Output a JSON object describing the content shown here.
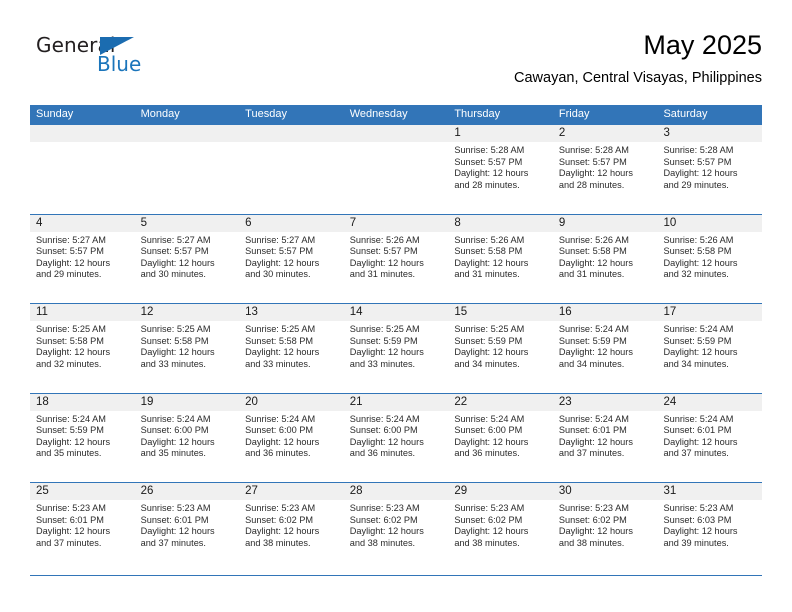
{
  "brand": {
    "name_part1": "General",
    "name_part2": "Blue",
    "flag_icon": "triangle-flag-icon"
  },
  "header": {
    "month_title": "May 2025",
    "location": "Cawayan, Central Visayas, Philippines"
  },
  "colors": {
    "header_blue": "#3275b8",
    "brand_blue": "#1b75bb",
    "day_band_gray": "#f0f0f0",
    "text": "#000000"
  },
  "weekdays": [
    "Sunday",
    "Monday",
    "Tuesday",
    "Wednesday",
    "Thursday",
    "Friday",
    "Saturday"
  ],
  "weeks": [
    [
      {
        "day": "",
        "empty": true
      },
      {
        "day": "",
        "empty": true
      },
      {
        "day": "",
        "empty": true
      },
      {
        "day": "",
        "empty": true
      },
      {
        "day": "1",
        "sunrise": "Sunrise: 5:28 AM",
        "sunset": "Sunset: 5:57 PM",
        "daylight1": "Daylight: 12 hours",
        "daylight2": "and 28 minutes."
      },
      {
        "day": "2",
        "sunrise": "Sunrise: 5:28 AM",
        "sunset": "Sunset: 5:57 PM",
        "daylight1": "Daylight: 12 hours",
        "daylight2": "and 28 minutes."
      },
      {
        "day": "3",
        "sunrise": "Sunrise: 5:28 AM",
        "sunset": "Sunset: 5:57 PM",
        "daylight1": "Daylight: 12 hours",
        "daylight2": "and 29 minutes."
      }
    ],
    [
      {
        "day": "4",
        "sunrise": "Sunrise: 5:27 AM",
        "sunset": "Sunset: 5:57 PM",
        "daylight1": "Daylight: 12 hours",
        "daylight2": "and 29 minutes."
      },
      {
        "day": "5",
        "sunrise": "Sunrise: 5:27 AM",
        "sunset": "Sunset: 5:57 PM",
        "daylight1": "Daylight: 12 hours",
        "daylight2": "and 30 minutes."
      },
      {
        "day": "6",
        "sunrise": "Sunrise: 5:27 AM",
        "sunset": "Sunset: 5:57 PM",
        "daylight1": "Daylight: 12 hours",
        "daylight2": "and 30 minutes."
      },
      {
        "day": "7",
        "sunrise": "Sunrise: 5:26 AM",
        "sunset": "Sunset: 5:57 PM",
        "daylight1": "Daylight: 12 hours",
        "daylight2": "and 31 minutes."
      },
      {
        "day": "8",
        "sunrise": "Sunrise: 5:26 AM",
        "sunset": "Sunset: 5:58 PM",
        "daylight1": "Daylight: 12 hours",
        "daylight2": "and 31 minutes."
      },
      {
        "day": "9",
        "sunrise": "Sunrise: 5:26 AM",
        "sunset": "Sunset: 5:58 PM",
        "daylight1": "Daylight: 12 hours",
        "daylight2": "and 31 minutes."
      },
      {
        "day": "10",
        "sunrise": "Sunrise: 5:26 AM",
        "sunset": "Sunset: 5:58 PM",
        "daylight1": "Daylight: 12 hours",
        "daylight2": "and 32 minutes."
      }
    ],
    [
      {
        "day": "11",
        "sunrise": "Sunrise: 5:25 AM",
        "sunset": "Sunset: 5:58 PM",
        "daylight1": "Daylight: 12 hours",
        "daylight2": "and 32 minutes."
      },
      {
        "day": "12",
        "sunrise": "Sunrise: 5:25 AM",
        "sunset": "Sunset: 5:58 PM",
        "daylight1": "Daylight: 12 hours",
        "daylight2": "and 33 minutes."
      },
      {
        "day": "13",
        "sunrise": "Sunrise: 5:25 AM",
        "sunset": "Sunset: 5:58 PM",
        "daylight1": "Daylight: 12 hours",
        "daylight2": "and 33 minutes."
      },
      {
        "day": "14",
        "sunrise": "Sunrise: 5:25 AM",
        "sunset": "Sunset: 5:59 PM",
        "daylight1": "Daylight: 12 hours",
        "daylight2": "and 33 minutes."
      },
      {
        "day": "15",
        "sunrise": "Sunrise: 5:25 AM",
        "sunset": "Sunset: 5:59 PM",
        "daylight1": "Daylight: 12 hours",
        "daylight2": "and 34 minutes."
      },
      {
        "day": "16",
        "sunrise": "Sunrise: 5:24 AM",
        "sunset": "Sunset: 5:59 PM",
        "daylight1": "Daylight: 12 hours",
        "daylight2": "and 34 minutes."
      },
      {
        "day": "17",
        "sunrise": "Sunrise: 5:24 AM",
        "sunset": "Sunset: 5:59 PM",
        "daylight1": "Daylight: 12 hours",
        "daylight2": "and 34 minutes."
      }
    ],
    [
      {
        "day": "18",
        "sunrise": "Sunrise: 5:24 AM",
        "sunset": "Sunset: 5:59 PM",
        "daylight1": "Daylight: 12 hours",
        "daylight2": "and 35 minutes."
      },
      {
        "day": "19",
        "sunrise": "Sunrise: 5:24 AM",
        "sunset": "Sunset: 6:00 PM",
        "daylight1": "Daylight: 12 hours",
        "daylight2": "and 35 minutes."
      },
      {
        "day": "20",
        "sunrise": "Sunrise: 5:24 AM",
        "sunset": "Sunset: 6:00 PM",
        "daylight1": "Daylight: 12 hours",
        "daylight2": "and 36 minutes."
      },
      {
        "day": "21",
        "sunrise": "Sunrise: 5:24 AM",
        "sunset": "Sunset: 6:00 PM",
        "daylight1": "Daylight: 12 hours",
        "daylight2": "and 36 minutes."
      },
      {
        "day": "22",
        "sunrise": "Sunrise: 5:24 AM",
        "sunset": "Sunset: 6:00 PM",
        "daylight1": "Daylight: 12 hours",
        "daylight2": "and 36 minutes."
      },
      {
        "day": "23",
        "sunrise": "Sunrise: 5:24 AM",
        "sunset": "Sunset: 6:01 PM",
        "daylight1": "Daylight: 12 hours",
        "daylight2": "and 37 minutes."
      },
      {
        "day": "24",
        "sunrise": "Sunrise: 5:24 AM",
        "sunset": "Sunset: 6:01 PM",
        "daylight1": "Daylight: 12 hours",
        "daylight2": "and 37 minutes."
      }
    ],
    [
      {
        "day": "25",
        "sunrise": "Sunrise: 5:23 AM",
        "sunset": "Sunset: 6:01 PM",
        "daylight1": "Daylight: 12 hours",
        "daylight2": "and 37 minutes."
      },
      {
        "day": "26",
        "sunrise": "Sunrise: 5:23 AM",
        "sunset": "Sunset: 6:01 PM",
        "daylight1": "Daylight: 12 hours",
        "daylight2": "and 37 minutes."
      },
      {
        "day": "27",
        "sunrise": "Sunrise: 5:23 AM",
        "sunset": "Sunset: 6:02 PM",
        "daylight1": "Daylight: 12 hours",
        "daylight2": "and 38 minutes."
      },
      {
        "day": "28",
        "sunrise": "Sunrise: 5:23 AM",
        "sunset": "Sunset: 6:02 PM",
        "daylight1": "Daylight: 12 hours",
        "daylight2": "and 38 minutes."
      },
      {
        "day": "29",
        "sunrise": "Sunrise: 5:23 AM",
        "sunset": "Sunset: 6:02 PM",
        "daylight1": "Daylight: 12 hours",
        "daylight2": "and 38 minutes."
      },
      {
        "day": "30",
        "sunrise": "Sunrise: 5:23 AM",
        "sunset": "Sunset: 6:02 PM",
        "daylight1": "Daylight: 12 hours",
        "daylight2": "and 38 minutes."
      },
      {
        "day": "31",
        "sunrise": "Sunrise: 5:23 AM",
        "sunset": "Sunset: 6:03 PM",
        "daylight1": "Daylight: 12 hours",
        "daylight2": "and 39 minutes."
      }
    ]
  ]
}
